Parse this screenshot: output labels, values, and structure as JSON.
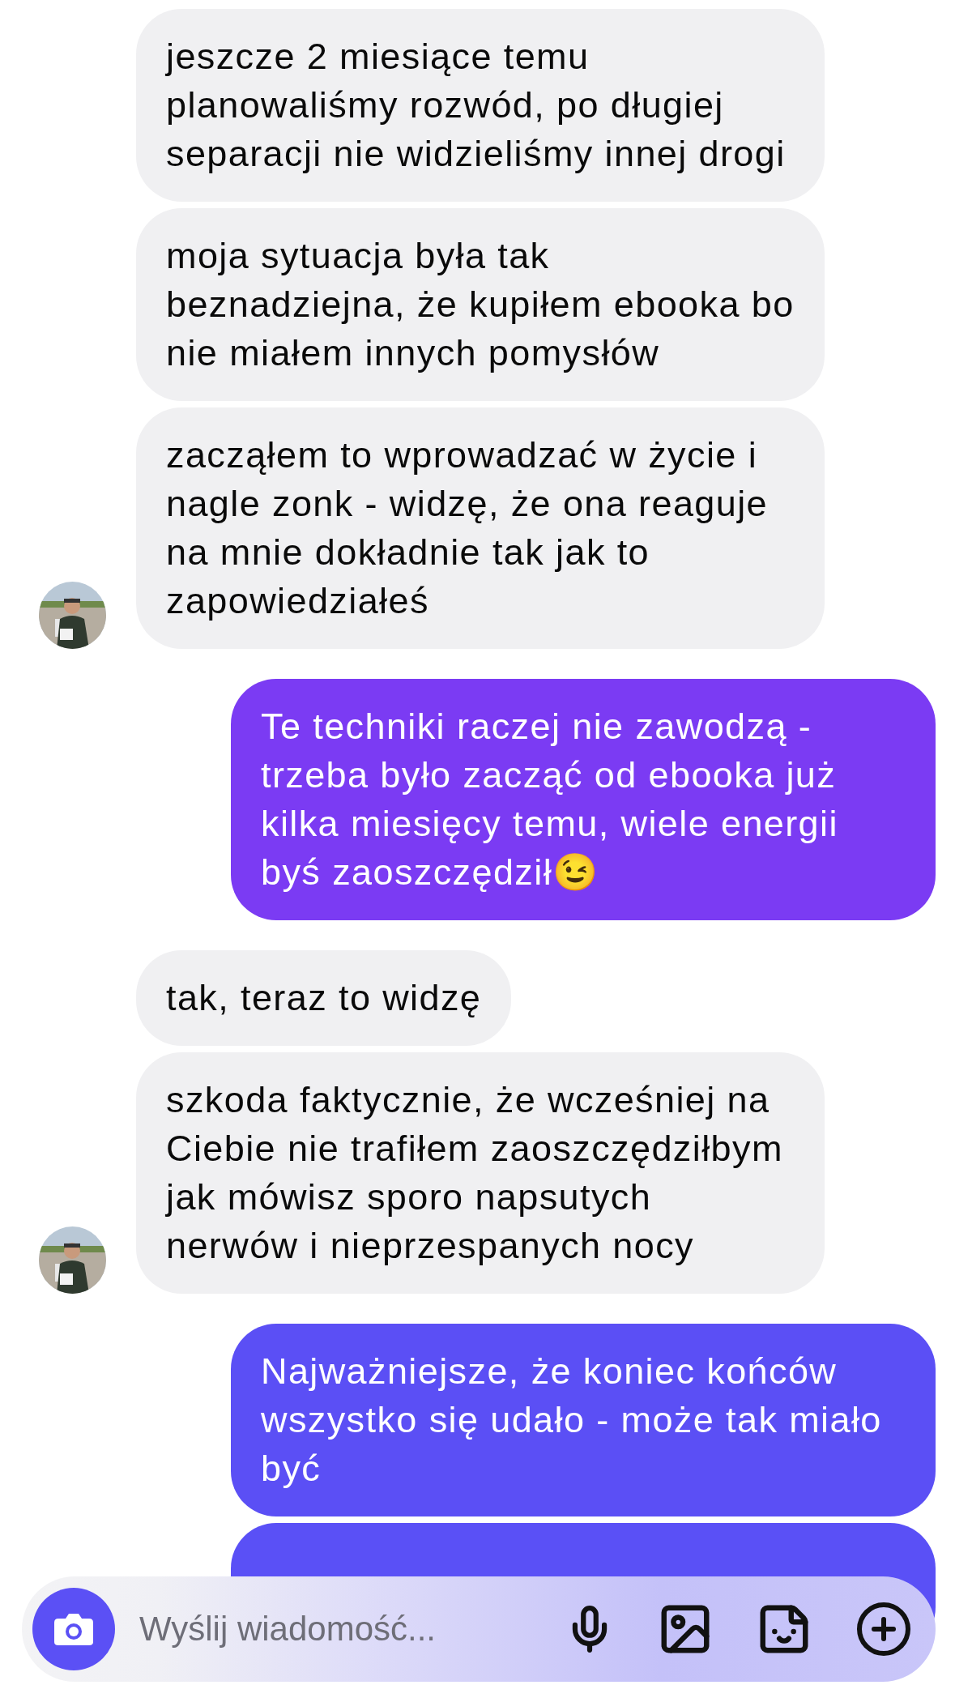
{
  "messages": [
    {
      "kind": "incoming",
      "text": "jeszcze 2 miesiące temu planowaliśmy rozwód, po długiej separacji nie widzieliśmy innej drogi",
      "avatar": false
    },
    {
      "kind": "incoming",
      "text": "moja sytuacja była tak beznadziejna, że kupiłem ebooka bo nie miałem innych pomysłów",
      "avatar": false
    },
    {
      "kind": "incoming",
      "text": "zacząłem to wprowadzać w życie i nagle zonk - widzę, że ona reaguje na mnie dokładnie tak jak to zapowiedziałeś",
      "avatar": true
    },
    {
      "kind": "outgoing",
      "text": "Te techniki raczej nie zawodzą - trzeba było zacząć od ebooka już kilka miesięcy temu, wiele energii byś zaoszczędził😉",
      "color": "#7b3bf3"
    },
    {
      "kind": "incoming",
      "text": "tak, teraz to widzę",
      "avatar": false
    },
    {
      "kind": "incoming",
      "text": "szkoda faktycznie, że wcześniej na Ciebie nie trafiłem zaoszczędziłbym jak mówisz sporo napsutych nerwów i nieprzespanych nocy",
      "avatar": true
    },
    {
      "kind": "outgoing",
      "text": "Najważniejsze, że koniec końców wszystko się udało - może tak miało być",
      "color": "#5b4ff5"
    },
    {
      "kind": "outgoing",
      "color": "#5a50f6"
    }
  ],
  "composer": {
    "placeholder": "Wyślij wiadomość..."
  }
}
